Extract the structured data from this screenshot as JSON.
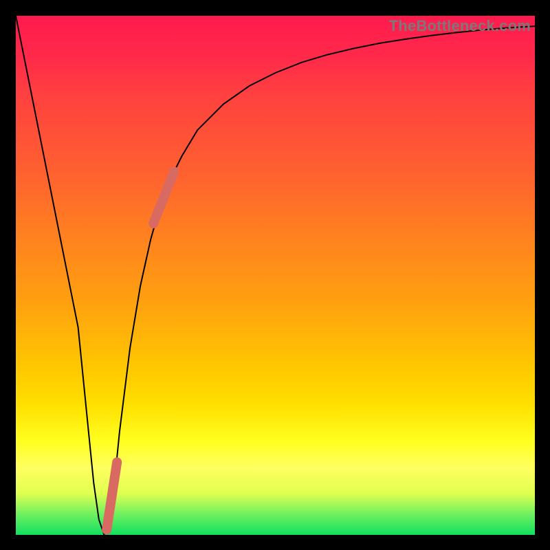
{
  "watermark": "TheBottleneck.com",
  "colors": {
    "background": "#000000",
    "curve": "#000000",
    "highlight": "#d86a62"
  },
  "chart_data": {
    "type": "line",
    "title": "",
    "xlabel": "",
    "ylabel": "",
    "xlim": [
      0,
      100
    ],
    "ylim": [
      0,
      100
    ],
    "grid": false,
    "series": [
      {
        "name": "bottleneck-curve",
        "x": [
          0,
          4,
          8,
          12,
          14,
          15,
          16,
          17,
          18,
          19,
          20,
          22,
          24,
          26,
          28,
          30,
          32,
          35,
          40,
          45,
          50,
          55,
          60,
          65,
          70,
          75,
          80,
          85,
          90,
          95,
          100
        ],
        "y": [
          100,
          80,
          60,
          40,
          20,
          10,
          3,
          0,
          3,
          10,
          20,
          36,
          48,
          57,
          64,
          69,
          73,
          78,
          83,
          86.5,
          89,
          91,
          92.5,
          93.7,
          94.7,
          95.5,
          96.2,
          96.8,
          97.3,
          97.7,
          98
        ]
      },
      {
        "name": "highlight-upper",
        "x": [
          26.5,
          30.5
        ],
        "y": [
          60,
          70
        ]
      },
      {
        "name": "highlight-lower",
        "x": [
          17.5,
          19.5
        ],
        "y": [
          1,
          14
        ]
      }
    ],
    "note": "y values read as percentage of plot height from bottom; curve is a V with minimum near x≈17 and asymptote near y≈98"
  }
}
